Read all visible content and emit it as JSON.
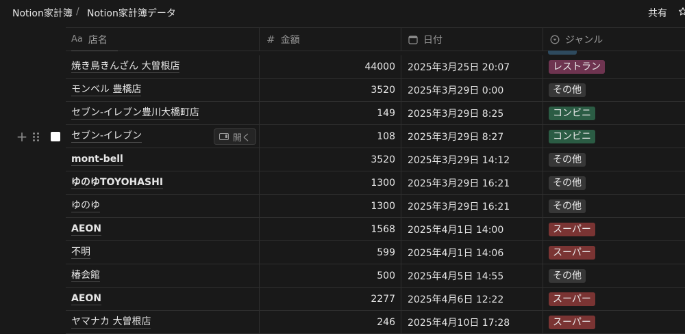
{
  "breadcrumb": {
    "workspace": "Notion家計簿",
    "separator": "/",
    "page": "Notion家計簿データ"
  },
  "topbar": {
    "share_label": "共有",
    "star_icon": "star-icon"
  },
  "columns": {
    "name": {
      "icon": "Aa",
      "label": "店名"
    },
    "amount": {
      "icon": "#",
      "label": "金額"
    },
    "date": {
      "icon": "calendar-icon",
      "label": "日付"
    },
    "genre": {
      "icon": "select-icon",
      "label": "ジャンル"
    }
  },
  "row_actions": {
    "open_label": "開く",
    "add_icon": "plus-icon",
    "drag_icon": "drag-handle-icon"
  },
  "tag_colors": {
    "レストラン": "#6e3450",
    "その他": "#373737",
    "コンビニ": "#2b5c44",
    "スーパー": "#7a3433"
  },
  "rows": [
    {
      "name": "焼き鳥きんざん 大曽根店",
      "bold": false,
      "amount": "44000",
      "date": "2025年3月25日 20:07",
      "genre": "レストラン"
    },
    {
      "name": "モンベル 豊橋店",
      "bold": false,
      "amount": "3520",
      "date": "2025年3月29日 0:00",
      "genre": "その他"
    },
    {
      "name": "セブン-イレブン豊川大橋町店",
      "bold": false,
      "amount": "149",
      "date": "2025年3月29日 8:25",
      "genre": "コンビニ"
    },
    {
      "name": "セブン-イレブン",
      "bold": false,
      "amount": "108",
      "date": "2025年3月29日 8:27",
      "genre": "コンビニ",
      "hovered": true
    },
    {
      "name": "mont-bell",
      "bold": true,
      "amount": "3520",
      "date": "2025年3月29日 14:12",
      "genre": "その他"
    },
    {
      "name": "ゆのゆTOYOHASHI",
      "bold": true,
      "amount": "1300",
      "date": "2025年3月29日 16:21",
      "genre": "その他"
    },
    {
      "name": "ゆのゆ",
      "bold": false,
      "amount": "1300",
      "date": "2025年3月29日 16:21",
      "genre": "その他"
    },
    {
      "name": "AEON",
      "bold": true,
      "amount": "1568",
      "date": "2025年4月1日 14:00",
      "genre": "スーパー"
    },
    {
      "name": "不明",
      "bold": false,
      "amount": "599",
      "date": "2025年4月1日 14:06",
      "genre": "スーパー"
    },
    {
      "name": "椿会館",
      "bold": false,
      "amount": "500",
      "date": "2025年4月5日 14:55",
      "genre": "その他"
    },
    {
      "name": "AEON",
      "bold": true,
      "amount": "2277",
      "date": "2025年4月6日 12:22",
      "genre": "スーパー"
    },
    {
      "name": "ヤマナカ 大曽根店",
      "bold": false,
      "amount": "246",
      "date": "2025年4月10日 17:28",
      "genre": "スーパー"
    }
  ]
}
